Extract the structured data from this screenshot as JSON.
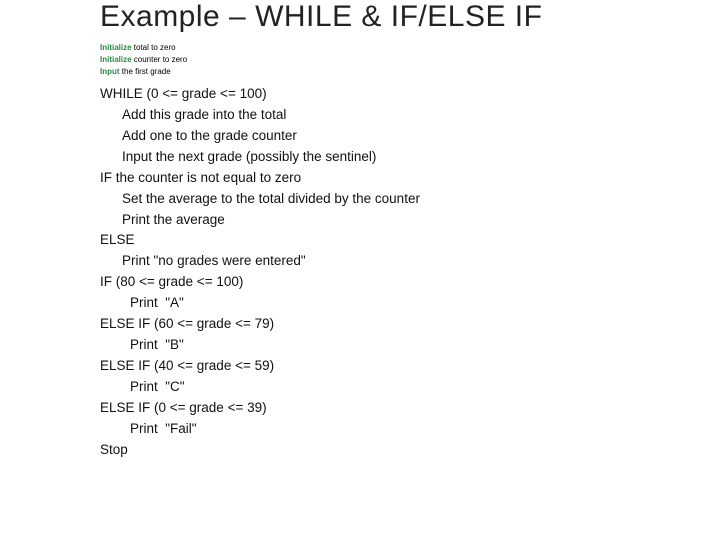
{
  "title": "Example – WHILE & IF/ELSE IF",
  "small": [
    {
      "kw": "Initialize",
      "rest": " total to zero"
    },
    {
      "kw": "Initialize",
      "rest": " counter to zero"
    },
    {
      "kw": "Input",
      "rest": " the first grade"
    }
  ],
  "lines": [
    {
      "t": "WHILE (0 <= grade <= 100)",
      "cls": ""
    },
    {
      "t": "Add this grade into the total",
      "cls": "indent1"
    },
    {
      "t": "Add one to the grade counter",
      "cls": "indent1"
    },
    {
      "t": "Input the next grade (possibly the sentinel)",
      "cls": "indent1"
    },
    {
      "t": "IF the counter is not equal to zero",
      "cls": ""
    },
    {
      "t": "Set the average to the total divided by the counter",
      "cls": "indent1"
    },
    {
      "t": "Print the average",
      "cls": "indent1"
    },
    {
      "t": "ELSE",
      "cls": ""
    },
    {
      "t": "Print \"no grades were entered\"",
      "cls": "indent1"
    },
    {
      "t": "IF (80 <= grade <= 100)",
      "cls": ""
    },
    {
      "t": "Print  \"A\"",
      "cls": "indent2"
    },
    {
      "t": "ELSE IF (60 <= grade <= 79)",
      "cls": ""
    },
    {
      "t": "Print  \"B\"",
      "cls": "indent2"
    },
    {
      "t": "ELSE IF (40 <= grade <= 59)",
      "cls": ""
    },
    {
      "t": "Print  \"C\"",
      "cls": "indent2"
    },
    {
      "t": "ELSE IF (0 <= grade <= 39)",
      "cls": ""
    },
    {
      "t": "Print  \"Fail\"",
      "cls": "indent2"
    },
    {
      "t": "Stop",
      "cls": ""
    }
  ]
}
